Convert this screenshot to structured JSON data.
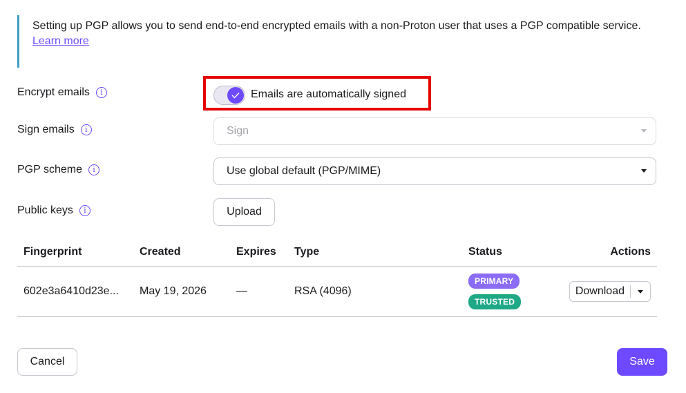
{
  "info": {
    "text": "Setting up PGP allows you to send end-to-end encrypted emails with a non-Proton user that uses a PGP compatible service.",
    "link": "Learn more"
  },
  "encrypt": {
    "label": "Encrypt emails",
    "toggle_on": true,
    "toggle_label": "Emails are automatically signed"
  },
  "sign": {
    "label": "Sign emails",
    "value": "Sign"
  },
  "scheme": {
    "label": "PGP scheme",
    "value": "Use global default (PGP/MIME)"
  },
  "public_keys": {
    "label": "Public keys",
    "upload_label": "Upload"
  },
  "table": {
    "headers": [
      "Fingerprint",
      "Created",
      "Expires",
      "Type",
      "Status",
      "Actions"
    ],
    "rows": [
      {
        "fingerprint": "602e3a6410d23e...",
        "created": "May 19, 2026",
        "expires": "—",
        "type": "RSA (4096)",
        "badges": [
          "PRIMARY",
          "TRUSTED"
        ],
        "action": "Download"
      }
    ]
  },
  "footer": {
    "cancel": "Cancel",
    "save": "Save"
  },
  "colors": {
    "accent": "#6d4aff",
    "primary_badge": "#8a6cf7",
    "trusted_badge": "#1ea885",
    "highlight": "#e60000",
    "info_border": "#3b9ec4"
  },
  "icons": {
    "info": "info-circle-icon",
    "check": "check-icon",
    "caret": "caret-down-icon"
  }
}
